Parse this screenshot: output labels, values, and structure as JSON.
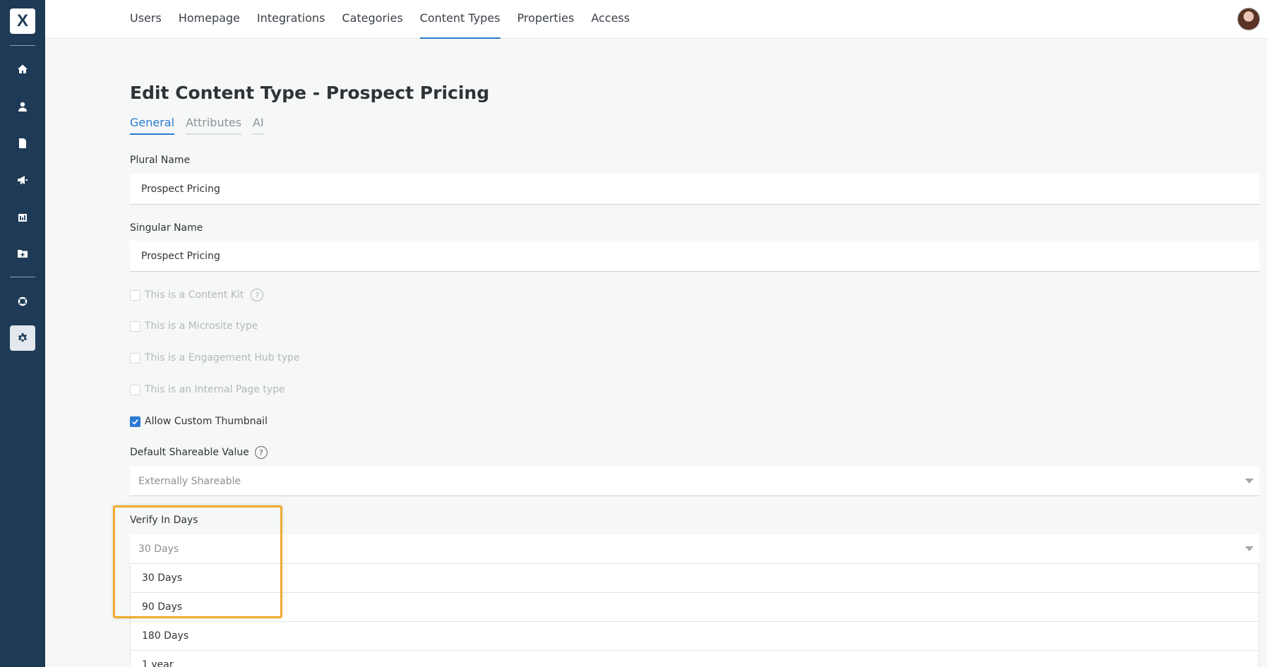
{
  "nav": {
    "items": [
      "Users",
      "Homepage",
      "Integrations",
      "Categories",
      "Content Types",
      "Properties",
      "Access"
    ],
    "active": "Content Types"
  },
  "page": {
    "title": "Edit Content Type - Prospect Pricing",
    "tabs": [
      "General",
      "Attributes",
      "AI"
    ],
    "active_tab": "General"
  },
  "form": {
    "plural_label": "Plural Name",
    "plural_value": "Prospect Pricing",
    "singular_label": "Singular Name",
    "singular_value": "Prospect Pricing",
    "checkboxes": [
      {
        "label": "This is a Content Kit",
        "checked": false,
        "disabled": true
      },
      {
        "label": "This is a Microsite type",
        "checked": false,
        "disabled": true
      },
      {
        "label": "This is a Engagement Hub type",
        "checked": false,
        "disabled": true
      },
      {
        "label": "This is an Internal Page type",
        "checked": false,
        "disabled": true
      },
      {
        "label": "Allow Custom Thumbnail",
        "checked": true,
        "disabled": false
      }
    ],
    "shareable_label": "Default Shareable Value",
    "shareable_value": "Externally Shareable",
    "verify_label": "Verify In Days",
    "verify_value": "30 Days",
    "verify_options": [
      "30 Days",
      "90 Days",
      "180 Days",
      "1 year"
    ]
  },
  "help_glyph": "?",
  "colors": {
    "sidebar": "#1e3a56",
    "accent": "#2a7ad2",
    "highlight": "#f2ab2d"
  }
}
